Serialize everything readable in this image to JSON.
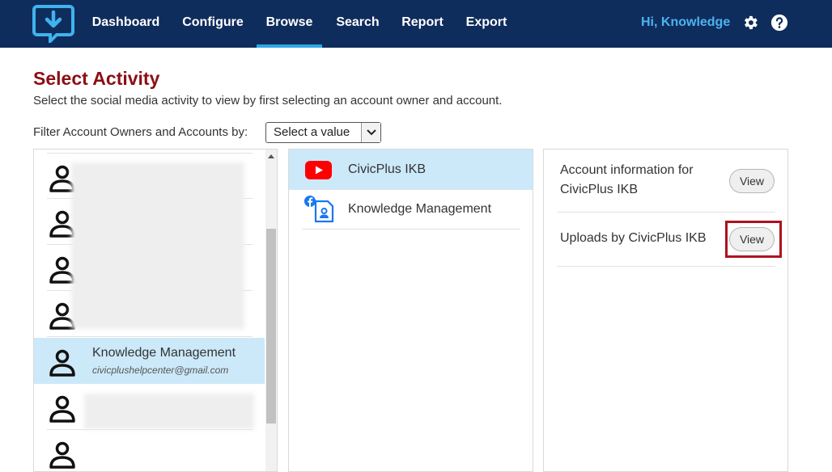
{
  "nav": {
    "items": [
      {
        "label": "Dashboard"
      },
      {
        "label": "Configure"
      },
      {
        "label": "Browse"
      },
      {
        "label": "Search"
      },
      {
        "label": "Report"
      },
      {
        "label": "Export"
      }
    ],
    "active": "Browse",
    "greeting": "Hi, Knowledge",
    "icons": [
      "app-logo-icon",
      "gear-icon",
      "help-icon"
    ]
  },
  "header": {
    "title": "Select Activity",
    "subtitle": "Select the social media activity to view by first selecting an account owner and account."
  },
  "filter": {
    "label": "Filter Account Owners and Accounts by:",
    "selected": "Select a value"
  },
  "owners": {
    "selected": {
      "name": "Knowledge Management",
      "email": "civicplushelpcenter@gmail.com"
    }
  },
  "accounts": [
    {
      "label": "CivicPlus IKB",
      "icon": "youtube-icon"
    },
    {
      "label": "Knowledge Management",
      "icon": "facebook-page-icon"
    }
  ],
  "activities": [
    {
      "label_line1": "Account information for",
      "label_line2": "CivicPlus IKB",
      "button": "View"
    },
    {
      "label_line1": "Uploads by CivicPlus IKB",
      "button": "View"
    }
  ],
  "colors": {
    "navbar": "#0f2d5c",
    "accent": "#2fa6e6",
    "title": "#8b0f14",
    "selection": "#cce9f9",
    "highlight": "#b01020"
  }
}
